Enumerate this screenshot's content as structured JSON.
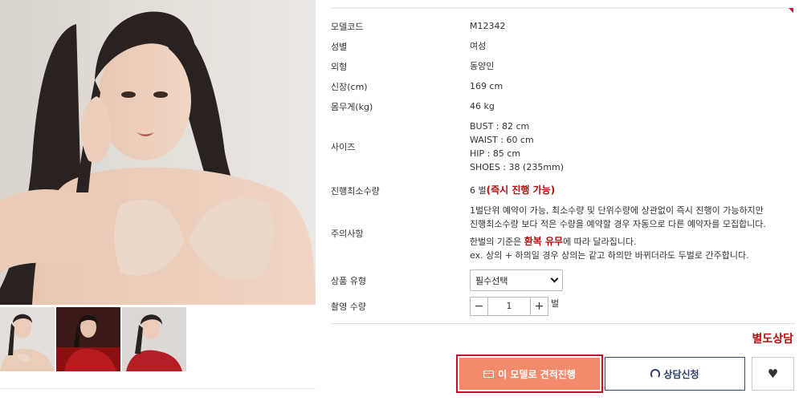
{
  "product": {
    "specs": [
      {
        "label": "모델코드",
        "value": "M12342"
      },
      {
        "label": "성별",
        "value": "여성"
      },
      {
        "label": "외형",
        "value": "동양인"
      },
      {
        "label": "신장(cm)",
        "value": "169 cm"
      },
      {
        "label": "몸무게(kg)",
        "value": "46 kg"
      }
    ],
    "size": {
      "label": "사이즈",
      "lines": [
        "BUST : 82 cm",
        "WAIST : 60 cm",
        "HIP : 85 cm",
        "SHOES : 38 (235mm)"
      ]
    },
    "min_qty": {
      "label": "진행최소수량",
      "value": "6 벌",
      "highlight": "(즉시 진행 가능)"
    },
    "notes": {
      "label": "주의사항",
      "line1": "1벌단위 예약이 가능, 최소수량 및 단위수량에 상관없이 즉시 진행이 가능하지만",
      "line2": "진행최소수량 보다 적은 수량을 예약할 경우 자동으로 다른 예약자를 모집합니다.",
      "line3_pre": "한벌의 기준은 ",
      "line3_em": "환복 유무",
      "line3_post": "에 따라 달라집니다.",
      "line4": "ex. 상의 + 하의일 경우 상의는 같고 하의만 바뀌더라도 두벌로 간주합니다."
    },
    "product_type": {
      "label": "상품 유형",
      "selected": "필수선택"
    },
    "shoot_qty": {
      "label": "촬영 수량",
      "minus": "−",
      "value": "1",
      "plus": "+",
      "unit": "벌"
    },
    "consult_note": "별도상담",
    "buttons": {
      "quote": "이 모델로 견적진행",
      "consult": "상담신청",
      "wish_icon": "heart-icon"
    }
  },
  "colors": {
    "accent_red": "#c8102e",
    "text_red": "#b40d0d",
    "quote_button": "#f48a6c",
    "consult_border": "#3a4a7a"
  }
}
